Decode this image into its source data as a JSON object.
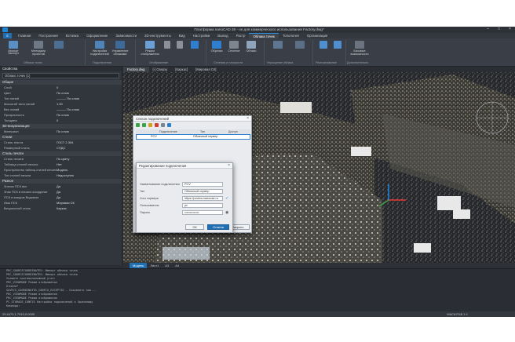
{
  "app": {
    "title": "Платформа nanoCAD 26 - не для коммерческого использования Factory.dwg*"
  },
  "ribbon_tabs": [
    {
      "label": "Главная",
      "active": false
    },
    {
      "label": "Построения",
      "active": false
    },
    {
      "label": "Вставка",
      "active": false
    },
    {
      "label": "Оформление",
      "active": false
    },
    {
      "label": "Зависимости",
      "active": false
    },
    {
      "label": "3D-инструменты",
      "active": false
    },
    {
      "label": "Вид",
      "active": false
    },
    {
      "label": "Настройки",
      "active": false
    },
    {
      "label": "Вывод",
      "active": false
    },
    {
      "label": "Растр",
      "active": false
    },
    {
      "label": "Облака точек",
      "active": true
    },
    {
      "label": "Топология",
      "active": false
    },
    {
      "label": "Организация",
      "active": false
    }
  ],
  "file_label": "",
  "ribbon": {
    "groups": [
      "Облака точек",
      "Подключения",
      "Отображение",
      "Сечения и плоскости",
      "Упрощение облака",
      "Распознавание",
      "Дополнительно"
    ],
    "buttons": [
      "Импорт",
      "Экспорт",
      "Менеджер проектов",
      "Настройки подключений",
      "Управление облаками",
      "Режим отображения",
      "Обрезка",
      "Сечение",
      "Облако",
      "Классификация",
      "Анализ",
      "Базовые возможности"
    ]
  },
  "properties": {
    "header": "Свойства",
    "selector": "Облако точек (1)",
    "sections": [
      {
        "title": "Общие",
        "rows": [
          {
            "k": "Слой",
            "v": "0"
          },
          {
            "k": "Цвет",
            "v": "По слою"
          },
          {
            "k": "Тип линий",
            "v": "——— По слою"
          },
          {
            "k": "Масштаб типа линий",
            "v": "1.00"
          },
          {
            "k": "Вес линий",
            "v": "——— По слою"
          },
          {
            "k": "Прозрачность",
            "v": "По слою"
          },
          {
            "k": "Толщина",
            "v": "0"
          }
        ]
      },
      {
        "title": "3D-визуализация",
        "rows": [
          {
            "k": "Материал",
            "v": "По слою"
          }
        ]
      },
      {
        "title": "Стили",
        "rows": [
          {
            "k": "Стиль текста",
            "v": "ГОСТ 2.304"
          },
          {
            "k": "Размерный стиль",
            "v": "СПДС"
          }
        ]
      },
      {
        "title": "Стиль печати",
        "rows": [
          {
            "k": "Стиль печати",
            "v": "По цвету"
          },
          {
            "k": "Таблица стилей печати",
            "v": "Нет"
          },
          {
            "k": "Пространство таблиц стилей печати",
            "v": "Модель"
          },
          {
            "k": "Тип стилей печати",
            "v": "Недоступно"
          }
        ]
      },
      {
        "title": "Разное",
        "rows": [
          {
            "k": "Значок ПСК вкл",
            "v": "Да"
          },
          {
            "k": "Знак ПСК в начало координат",
            "v": "Да"
          },
          {
            "k": "ПСК в каждом Видовом",
            "v": "Да"
          },
          {
            "k": "Имя ПСК",
            "v": "Мировая СК"
          },
          {
            "k": "Визуальный стиль",
            "v": "Каркас"
          }
        ]
      }
    ]
  },
  "viewport": {
    "tabs": [
      {
        "label": "Factory.dwg",
        "active": true
      },
      {
        "label": "[-] Сверху",
        "active": false
      },
      {
        "label": "[Каркас]",
        "active": false
      },
      {
        "label": "[Мировая СК]",
        "active": false
      }
    ],
    "layout_tabs": [
      {
        "label": "Модель",
        "active": true
      },
      {
        "label": "Лист1",
        "active": false
      },
      {
        "label": "А3",
        "active": false
      },
      {
        "label": "А4",
        "active": false
      }
    ]
  },
  "dialog_list": {
    "title": "Список подключений",
    "col_name": "Подключение",
    "col_type": "Тип",
    "col_access": "Доступ",
    "rows": [
      {
        "name": "PCV",
        "type": "Облачный сервер",
        "access": ""
      }
    ]
  },
  "dialog_edit": {
    "title": "Редактирование подключения",
    "name_label": "Наименование подключения",
    "name_value": "PCV",
    "type_label": "Тип",
    "type_value": "Облачный сервер",
    "host_label": "Хост сервера",
    "host_value": "https://pcview.nanocad.ru",
    "user_label": "Пользователь",
    "user_value": "pc",
    "pass_label": "Пароль",
    "pass_value": "••••••••••••••",
    "ok": "ОК",
    "cancel": "Отмена",
    "close": "Закрыть"
  },
  "console": {
    "lines": [
      "PRC_SOURCECOORDINATES:  Импорт облака точек",
      "PRC_SOURCECOORDINATES:  Импорт облака точек",
      "Укажите противоположный угол:",
      "PRC_VIEWMODE  Режим отображения",
      "Отмена*",
      "SAVECS_COORDINATES_CONFIG_EXCEPTIO - Сохранить как...",
      "PRC_VIEWMODE  Режим отображения",
      "PRC_VIEWMODE  Режим отображения",
      "PC_STORAGE_CONFIG  Настройки подключений к Хранилищу",
      "Команда:"
    ]
  },
  "status": {
    "coords": "29.4470,1.7010,0.0000",
    "right": "МАСШТАБ 1:1"
  },
  "colors": {
    "accent": "#1f6fb2",
    "axis_x": "#e53935",
    "axis_y": "#43a047",
    "axis_z": "#1e88e5"
  }
}
